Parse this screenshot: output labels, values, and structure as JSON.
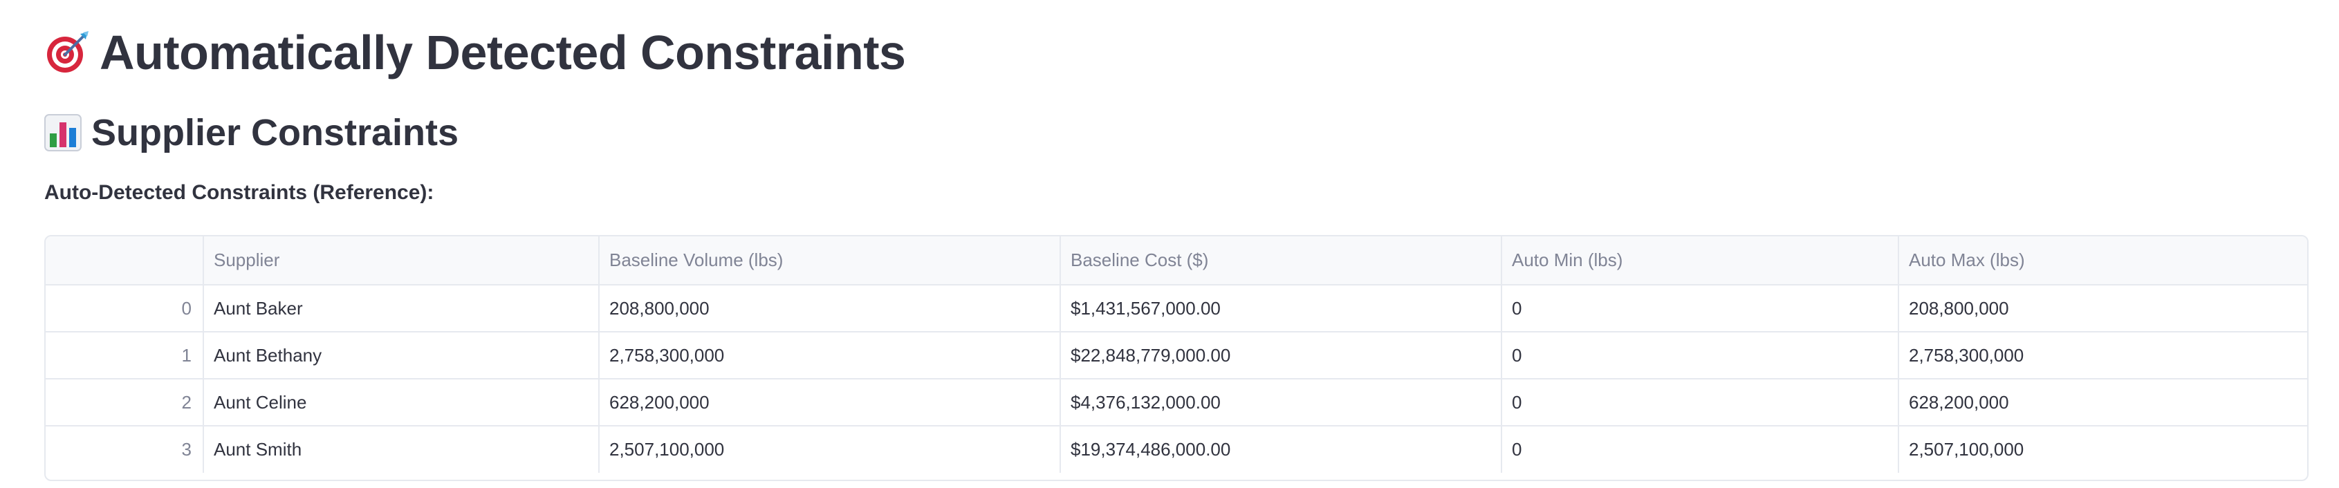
{
  "header": {
    "title": "Automatically Detected Constraints",
    "title_icon": "target-dart-icon"
  },
  "section": {
    "title": "Supplier Constraints",
    "title_icon": "bar-chart-icon",
    "subheading": "Auto-Detected Constraints (Reference):"
  },
  "table": {
    "columns": [
      "",
      "Supplier",
      "Baseline Volume (lbs)",
      "Baseline Cost ($)",
      "Auto Min (lbs)",
      "Auto Max (lbs)"
    ],
    "rows": [
      {
        "index": "0",
        "supplier": "Aunt Baker",
        "volume": "208,800,000",
        "cost": "$1,431,567,000.00",
        "min": "0",
        "max": "208,800,000"
      },
      {
        "index": "1",
        "supplier": "Aunt Bethany",
        "volume": "2,758,300,000",
        "cost": "$22,848,779,000.00",
        "min": "0",
        "max": "2,758,300,000"
      },
      {
        "index": "2",
        "supplier": "Aunt Celine",
        "volume": "628,200,000",
        "cost": "$4,376,132,000.00",
        "min": "0",
        "max": "628,200,000"
      },
      {
        "index": "3",
        "supplier": "Aunt Smith",
        "volume": "2,507,100,000",
        "cost": "$19,374,486,000.00",
        "min": "0",
        "max": "2,507,100,000"
      }
    ]
  },
  "colors": {
    "text": "#31333f",
    "muted": "#808495",
    "border": "#e6e9ef",
    "header_bg": "#f8f9fb"
  }
}
